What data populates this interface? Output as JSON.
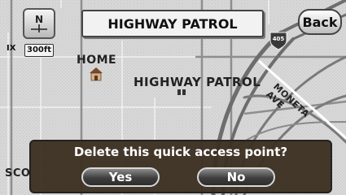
{
  "title_bar": {
    "label": "HIGHWAY PATROL"
  },
  "back_button": {
    "label": "Back"
  },
  "compass": {
    "label": "N",
    "icon": "north-arrow-icon"
  },
  "scale": {
    "value": "300ft",
    "left_label": "IX"
  },
  "map": {
    "labels": {
      "home": "HOME",
      "highway_patrol": "HIGHWAY PATROL",
      "street": "MONETA AVE",
      "sco": "SCO",
      "route": "405"
    }
  },
  "dialog": {
    "message": "Delete this quick access point?",
    "yes": "Yes",
    "no": "No"
  }
}
